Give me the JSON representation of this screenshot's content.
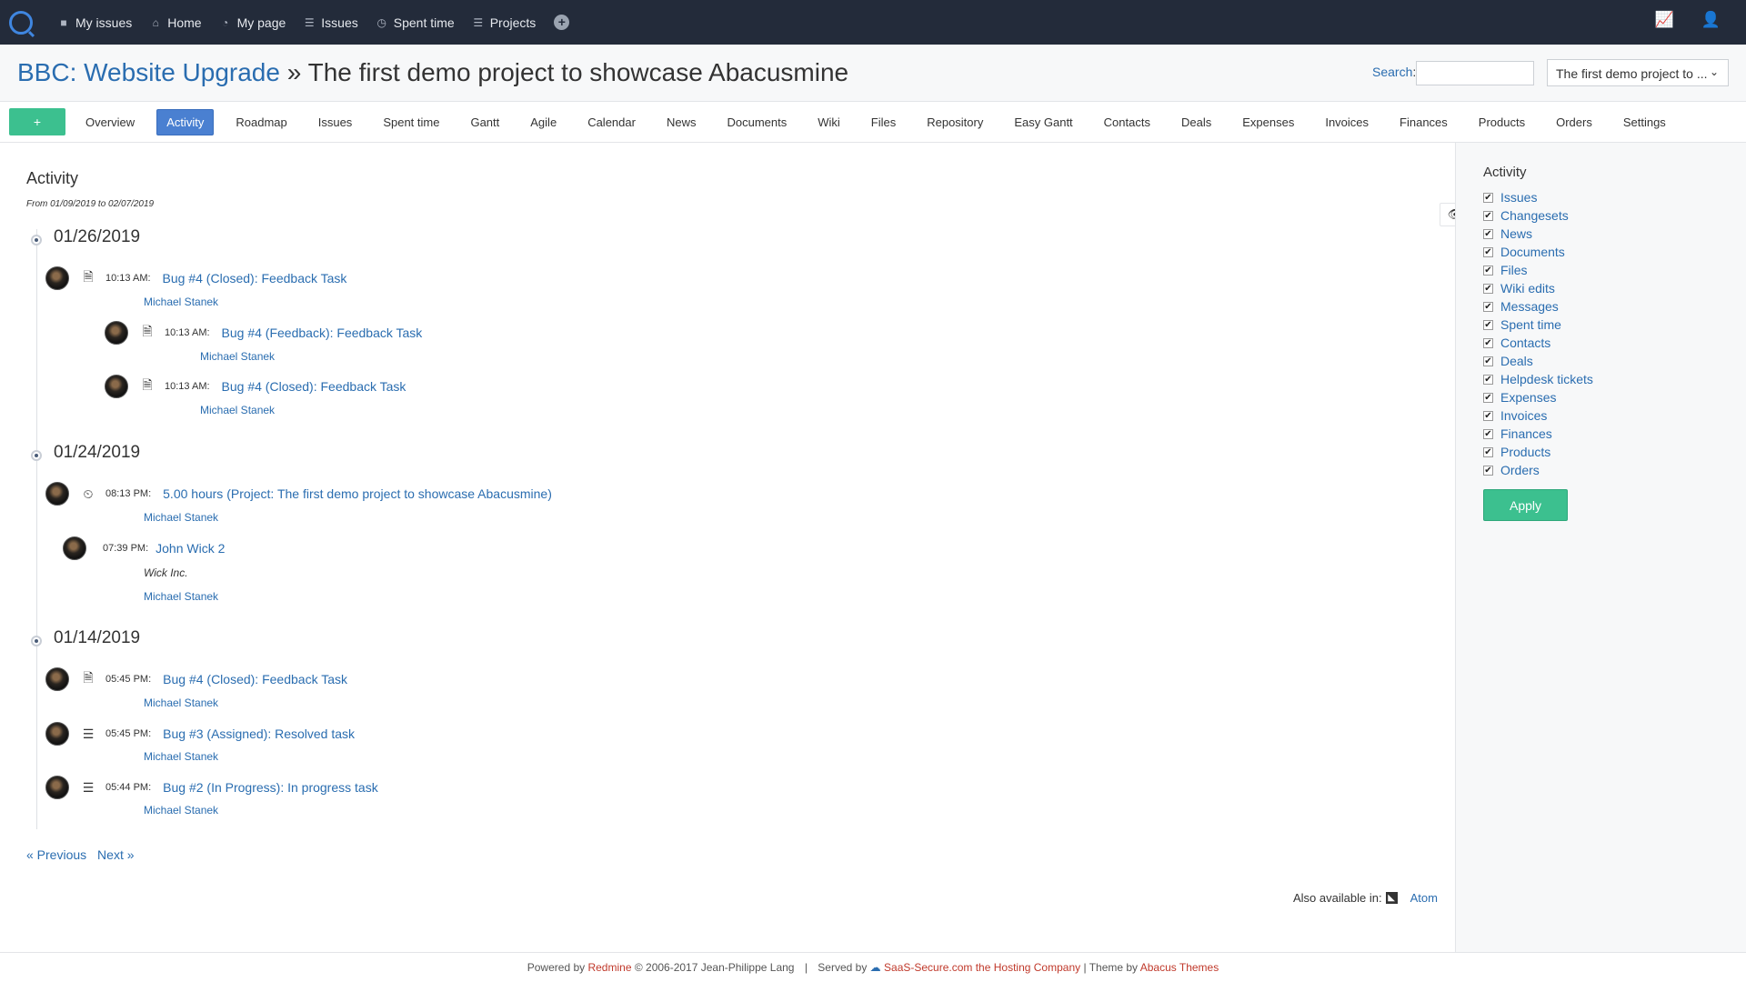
{
  "topnav": {
    "items": [
      "My issues",
      "Home",
      "My page",
      "Issues",
      "Spent time",
      "Projects"
    ]
  },
  "header": {
    "parent_project": "BBC: Website Upgrade",
    "separator": "»",
    "project": "The first demo project to showcase Abacusmine",
    "search_label": "Search",
    "project_select": "The first demo project to ..."
  },
  "tabs": {
    "new_label": "+",
    "items": [
      "Overview",
      "Activity",
      "Roadmap",
      "Issues",
      "Spent time",
      "Gantt",
      "Agile",
      "Calendar",
      "News",
      "Documents",
      "Wiki",
      "Files",
      "Repository",
      "Easy Gantt",
      "Contacts",
      "Deals",
      "Expenses",
      "Invoices",
      "Finances",
      "Products",
      "Orders",
      "Settings"
    ],
    "active": "Activity"
  },
  "main": {
    "title": "Activity",
    "range": "From 01/09/2019 to 02/07/2019",
    "days": [
      {
        "date": "01/26/2019",
        "entries": [
          {
            "icon": "document-icon",
            "time": "10:13 AM:",
            "title": "Bug #4 (Closed): Feedback Task",
            "author": "Michael Stanek"
          },
          {
            "icon": "document-icon",
            "time": "10:13 AM:",
            "title": "Bug #4 (Feedback): Feedback Task",
            "author": "Michael Stanek"
          },
          {
            "icon": "document-icon",
            "time": "10:13 AM:",
            "title": "Bug #4 (Closed): Feedback Task",
            "author": "Michael Stanek"
          }
        ]
      },
      {
        "date": "01/24/2019",
        "entries": [
          {
            "icon": "clock-icon",
            "time": "08:13 PM:",
            "title": "5.00 hours (Project: The first demo project to showcase Abacusmine)",
            "author": "Michael Stanek"
          },
          {
            "icon": "",
            "time": "07:39 PM:",
            "title": "John Wick 2",
            "description": "Wick Inc.",
            "author": "Michael Stanek"
          }
        ]
      },
      {
        "date": "01/14/2019",
        "entries": [
          {
            "icon": "document-icon",
            "time": "05:45 PM:",
            "title": "Bug #4 (Closed): Feedback Task",
            "author": "Michael Stanek"
          },
          {
            "icon": "list-icon",
            "time": "05:45 PM:",
            "title": "Bug #3 (Assigned): Resolved task",
            "author": "Michael Stanek"
          },
          {
            "icon": "list-icon",
            "time": "05:44 PM:",
            "title": "Bug #2 (In Progress): In progress task",
            "author": "Michael Stanek"
          }
        ]
      }
    ],
    "pager": {
      "previous": "« Previous",
      "next": "Next »"
    },
    "also_available": "Also available in:",
    "atom": "Atom"
  },
  "sidebar": {
    "title": "Activity",
    "filters": [
      "Issues",
      "Changesets",
      "News",
      "Documents",
      "Files",
      "Wiki edits",
      "Messages",
      "Spent time",
      "Contacts",
      "Deals",
      "Helpdesk tickets",
      "Expenses",
      "Invoices",
      "Finances",
      "Products",
      "Orders"
    ],
    "all_checked": true,
    "apply": "Apply"
  },
  "footer": {
    "powered_by": "Powered by",
    "redmine": "Redmine",
    "copyright": "© 2006-2017 Jean-Philippe Lang",
    "pipe": "|",
    "served_by": "Served by",
    "host": "SaaS-Secure.com the Hosting Company",
    "theme_by": "| Theme by",
    "theme": "Abacus Themes"
  },
  "colors": {
    "topbar": "#232b3a",
    "link": "#2a6db0",
    "green": "#3cc08f",
    "active_tab": "#4a80d1",
    "footer_link": "#c0392b"
  }
}
